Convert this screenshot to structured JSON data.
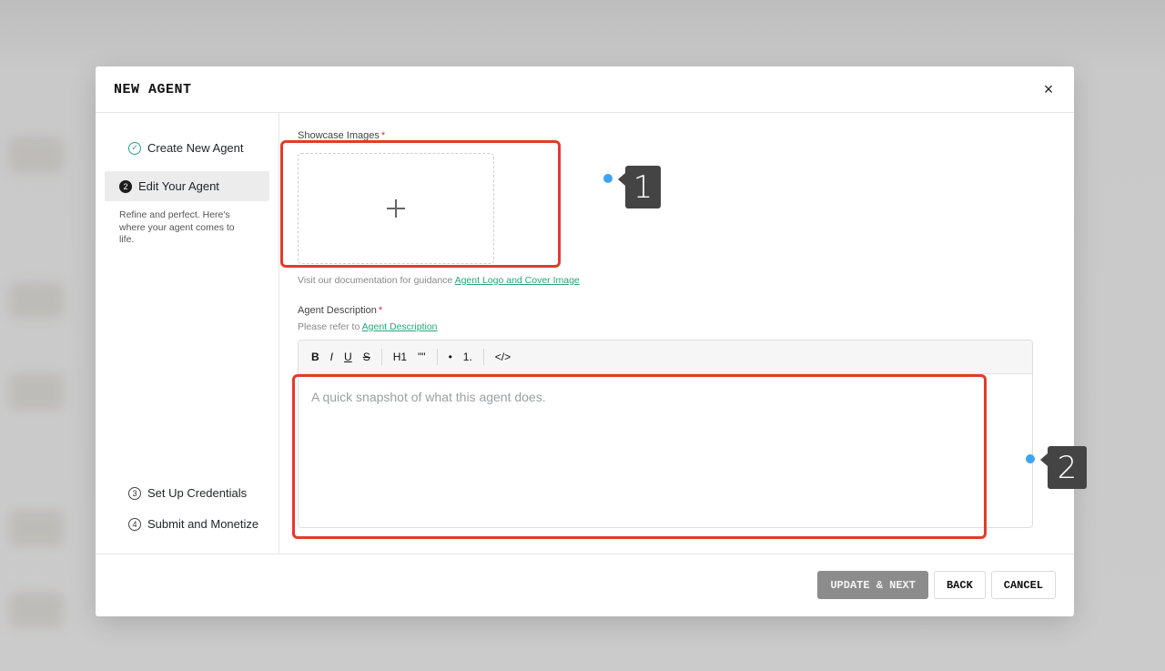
{
  "modal": {
    "title": "NEW AGENT",
    "close_symbol": "×"
  },
  "steps": [
    {
      "number": "✓",
      "label": "Create New Agent",
      "state": "done",
      "icon": "check-circle-icon"
    },
    {
      "number": "2",
      "label": "Edit Your Agent",
      "state": "active",
      "description": "Refine and perfect. Here's where your agent comes to life."
    },
    {
      "number": "3",
      "label": "Set Up Credentials",
      "state": "pending"
    },
    {
      "number": "4",
      "label": "Submit and Monetize",
      "state": "pending"
    }
  ],
  "showcase": {
    "label": "Showcase Images",
    "required": "*",
    "hint_text": "Visit our documentation for guidance",
    "hint_link": "Agent Logo and Cover Image"
  },
  "description": {
    "label": "Agent Description",
    "required": "*",
    "hint_text": "Please refer to",
    "hint_link": "Agent Description",
    "placeholder": "A quick snapshot of what this agent does."
  },
  "toolbar": {
    "bold": "B",
    "italic": "I",
    "underline": "U",
    "strike": "S",
    "heading": "H1",
    "quote": "\"\"",
    "bullet": "•",
    "ordered": "1.",
    "code": "</>"
  },
  "footer": {
    "update_next": "UPDATE & NEXT",
    "back": "BACK",
    "cancel": "CANCEL"
  },
  "annotations": [
    {
      "label": "1"
    },
    {
      "label": "2"
    }
  ],
  "colors": {
    "accent": "#2aa37a",
    "highlight": "#e23b2a",
    "marker_dot": "#3ea3f2",
    "primary_disabled": "#8c8c8c"
  }
}
